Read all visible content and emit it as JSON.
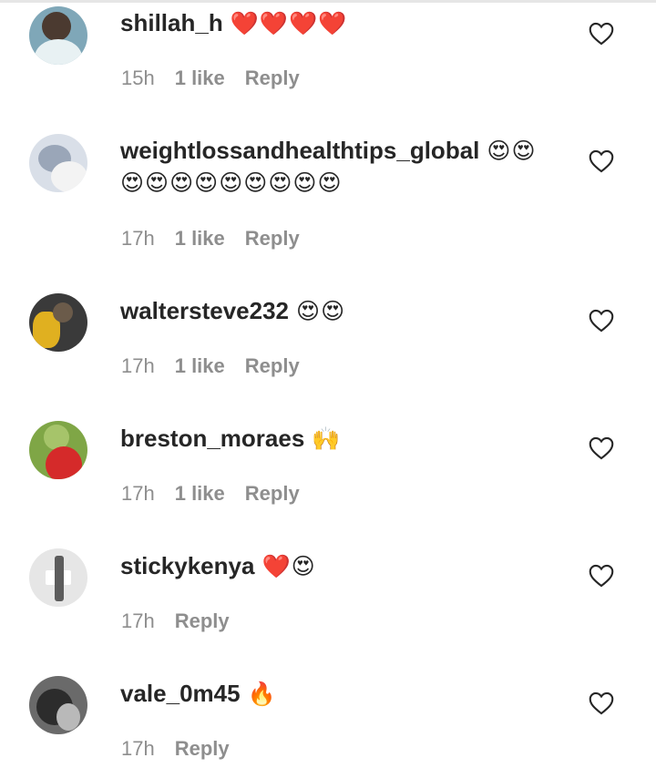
{
  "comments": [
    {
      "username": "shillah_h",
      "text": "❤️❤️❤️❤️",
      "text2": "",
      "time": "15h",
      "likes": "1 like",
      "reply": "Reply",
      "avatar": {
        "bg": "#7fa7b8",
        "c1": "#4b3a30",
        "c2": "#e8f1f3"
      }
    },
    {
      "username": "weightlossandhealthtips_global",
      "text": "😍😍",
      "text2": "😍😍😍😍😍😍😍😍😍",
      "time": "17h",
      "likes": "1 like",
      "reply": "Reply",
      "avatar": {
        "bg": "#d9dfe8",
        "c1": "#9aa6b8",
        "c2": "#f3f3f3"
      }
    },
    {
      "username": "waltersteve232",
      "text": "😍😍",
      "text2": "",
      "time": "17h",
      "likes": "1 like",
      "reply": "Reply",
      "avatar": {
        "bg": "#3a3a3a",
        "c1": "#e0b020",
        "c2": "#6b5b4a"
      }
    },
    {
      "username": "breston_moraes",
      "text": "🙌",
      "text2": "",
      "time": "17h",
      "likes": "1 like",
      "reply": "Reply",
      "avatar": {
        "bg": "#7fa646",
        "c1": "#d52a2a",
        "c2": "#a6c46a"
      }
    },
    {
      "username": "stickykenya",
      "text": "❤️😍",
      "text2": "",
      "time": "17h",
      "likes": "",
      "reply": "Reply",
      "avatar": {
        "bg": "#e6e6e6",
        "c1": "#ffffff",
        "c2": "#5c5c5c"
      }
    },
    {
      "username": "vale_0m45",
      "text": "🔥",
      "text2": "",
      "time": "17h",
      "likes": "",
      "reply": "Reply",
      "avatar": {
        "bg": "#6a6a6a",
        "c1": "#2c2c2c",
        "c2": "#b9b9b9"
      }
    }
  ]
}
